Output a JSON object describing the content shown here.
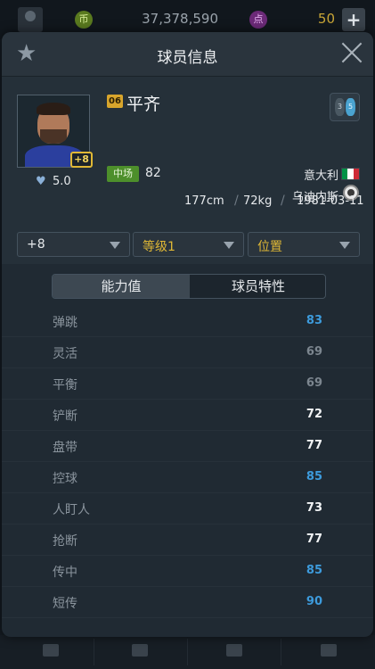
{
  "topbar": {
    "coin_icon_label": "币",
    "coins": "37,378,590",
    "point_icon_label": "点",
    "points": "50",
    "add_label": "+"
  },
  "modal": {
    "title": "球员信息",
    "star_icon": "★"
  },
  "player": {
    "season_badge": "06",
    "name": "平齐",
    "position_label": "中场",
    "position_value": "82",
    "nation": "意大利",
    "club": "乌迪内斯",
    "enhance": "+8",
    "rating": "5.0",
    "height": "177cm",
    "separator": "/",
    "weight": "72kg",
    "birthdate": "1981-03-11",
    "foot_left": "3",
    "foot_right": "5",
    "flag_colors": [
      "#009246",
      "#ffffff",
      "#ce2b37"
    ]
  },
  "filters": {
    "enhance_select": "+8",
    "level_select": "等级1",
    "position_select": "位置"
  },
  "tabs": {
    "ability": "能力值",
    "traits": "球员特性"
  },
  "abilities": [
    {
      "name": "弹跳",
      "value": "83",
      "color": "#3d9bdc"
    },
    {
      "name": "灵活",
      "value": "69",
      "color": "#7c868f"
    },
    {
      "name": "平衡",
      "value": "69",
      "color": "#7c868f"
    },
    {
      "name": "铲断",
      "value": "72",
      "color": "#f1f3f5"
    },
    {
      "name": "盘带",
      "value": "77",
      "color": "#f1f3f5"
    },
    {
      "name": "控球",
      "value": "85",
      "color": "#3d9bdc"
    },
    {
      "name": "人盯人",
      "value": "73",
      "color": "#f1f3f5"
    },
    {
      "name": "抢断",
      "value": "77",
      "color": "#f1f3f5"
    },
    {
      "name": "传中",
      "value": "85",
      "color": "#3d9bdc"
    },
    {
      "name": "短传",
      "value": "90",
      "color": "#3d9bdc"
    }
  ]
}
